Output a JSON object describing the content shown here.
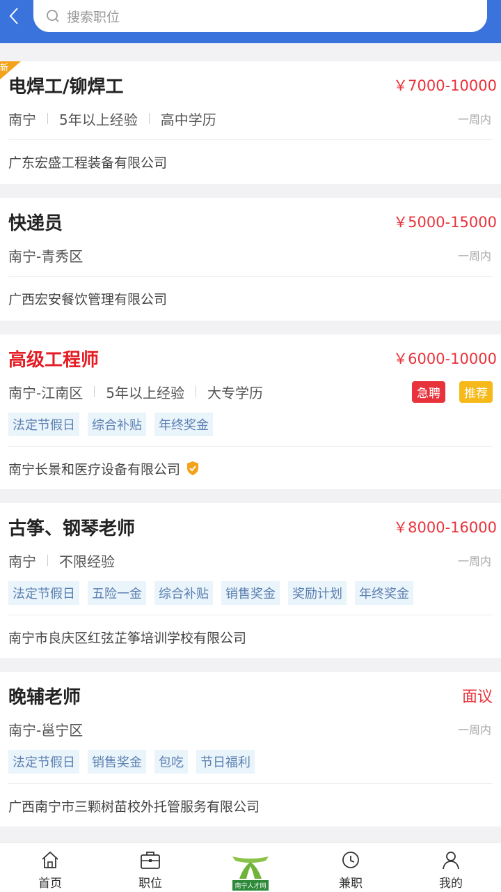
{
  "header": {
    "search_placeholder": "搜索职位"
  },
  "jobs": [
    {
      "title": "电焊工/铆焊工",
      "salary": "￥7000-10000",
      "meta": [
        "南宁",
        "5年以上经验",
        "高中学历"
      ],
      "time": "一周内",
      "company": "广东宏盛工程装备有限公司",
      "new_label": "新"
    },
    {
      "title": "快递员",
      "salary": "￥5000-15000",
      "meta": [
        "南宁-青秀区"
      ],
      "time": "一周内",
      "company": "广西宏安餐饮管理有限公司"
    },
    {
      "title": "高级工程师",
      "salary": "￥6000-10000",
      "meta": [
        "南宁-江南区",
        "5年以上经验",
        "大专学历"
      ],
      "badges": [
        "急聘",
        "推荐"
      ],
      "tags": [
        "法定节假日",
        "综合补贴",
        "年终奖金"
      ],
      "company": "南宁长景和医疗设备有限公司"
    },
    {
      "title": "古筝、钢琴老师",
      "salary": "￥8000-16000",
      "meta": [
        "南宁",
        "不限经验"
      ],
      "time": "一周内",
      "tags": [
        "法定节假日",
        "五险一金",
        "综合补贴",
        "销售奖金",
        "奖励计划",
        "年终奖金"
      ],
      "company": "南宁市良庆区红弦芷筝培训学校有限公司"
    },
    {
      "title": "晚辅老师",
      "salary": "面议",
      "meta": [
        "南宁-邕宁区"
      ],
      "time": "一周内",
      "tags": [
        "法定节假日",
        "销售奖金",
        "包吃",
        "节日福利"
      ],
      "company": "广西南宁市三颗树苗校外托管服务有限公司"
    }
  ],
  "tabbar": {
    "home": "首页",
    "jobs": "职位",
    "logo": "南宁人才网",
    "parttime": "兼职",
    "mine": "我的"
  },
  "colors": {
    "header": "#3a73db",
    "salary": "#e8333c",
    "urgent": "#e8333c",
    "recommend": "#f6b91a"
  }
}
